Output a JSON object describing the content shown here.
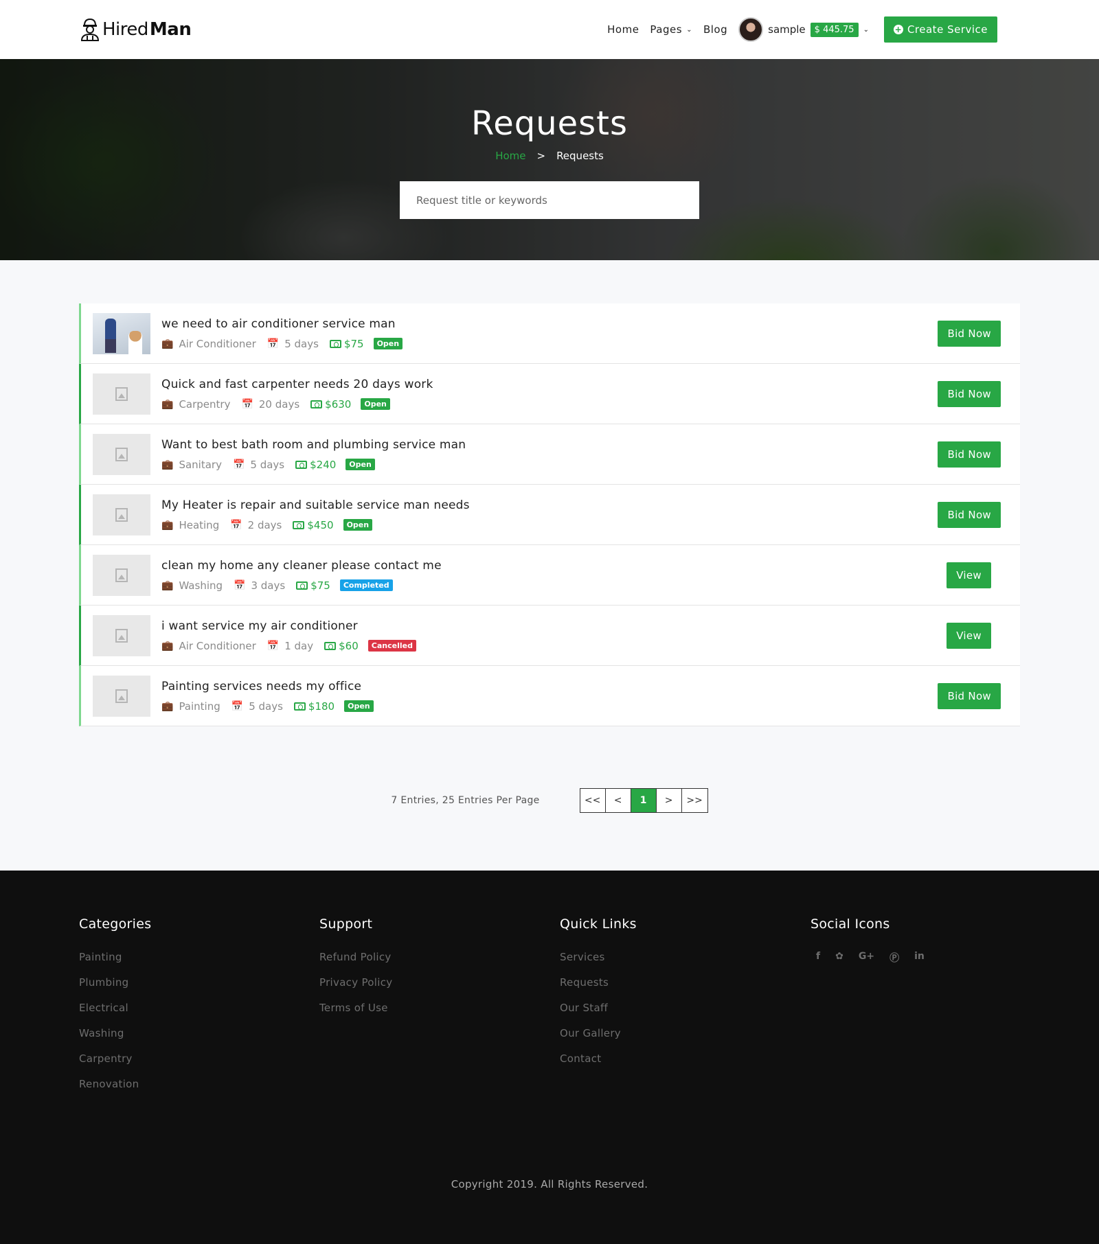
{
  "header": {
    "logo_light": "Hired",
    "logo_bold": "Man",
    "nav": [
      "Home",
      "Pages",
      "Blog"
    ],
    "user_name": "sample",
    "balance": "$ 445.75",
    "create_label": "Create Service"
  },
  "hero": {
    "title": "Requests",
    "breadcrumb_home": "Home",
    "breadcrumb_sep": ">",
    "breadcrumb_current": "Requests",
    "search_placeholder": "Request title or keywords"
  },
  "requests": [
    {
      "title": "we need to air conditioner service man",
      "category": "Air Conditioner",
      "duration": "5 days",
      "price": "$75",
      "status": "Open",
      "status_type": "open",
      "action": "Bid Now",
      "thumb": "photo"
    },
    {
      "title": "Quick and fast carpenter needs 20 days work",
      "category": "Carpentry",
      "duration": "20 days",
      "price": "$630",
      "status": "Open",
      "status_type": "open",
      "action": "Bid Now",
      "thumb": "placeholder"
    },
    {
      "title": "Want to best bath room and plumbing service man",
      "category": "Sanitary",
      "duration": "5 days",
      "price": "$240",
      "status": "Open",
      "status_type": "open",
      "action": "Bid Now",
      "thumb": "placeholder"
    },
    {
      "title": "My Heater is repair and suitable service man needs",
      "category": "Heating",
      "duration": "2 days",
      "price": "$450",
      "status": "Open",
      "status_type": "open",
      "action": "Bid Now",
      "thumb": "placeholder"
    },
    {
      "title": "clean my home any cleaner please contact me",
      "category": "Washing",
      "duration": "3 days",
      "price": "$75",
      "status": "Completed",
      "status_type": "completed",
      "action": "View",
      "thumb": "placeholder"
    },
    {
      "title": "i want service my air conditioner",
      "category": "Air Conditioner",
      "duration": "1 day",
      "price": "$60",
      "status": "Cancelled",
      "status_type": "cancelled",
      "action": "View",
      "thumb": "placeholder"
    },
    {
      "title": "Painting services needs my office",
      "category": "Painting",
      "duration": "5 days",
      "price": "$180",
      "status": "Open",
      "status_type": "open",
      "action": "Bid Now",
      "thumb": "placeholder"
    }
  ],
  "pagination": {
    "summary": "7 Entries, 25 Entries Per Page",
    "first": "<<",
    "prev": "<",
    "current": "1",
    "next": ">",
    "last": ">>"
  },
  "footer": {
    "categories_title": "Categories",
    "categories": [
      "Painting",
      "Plumbing",
      "Electrical",
      "Washing",
      "Carpentry",
      "Renovation"
    ],
    "support_title": "Support",
    "support": [
      "Refund Policy",
      "Privacy Policy",
      "Terms of Use"
    ],
    "links_title": "Quick Links",
    "links": [
      "Services",
      "Requests",
      "Our Staff",
      "Our Gallery",
      "Contact"
    ],
    "social_title": "Social Icons",
    "social_icons": [
      "facebook-icon",
      "twitter-icon",
      "google-plus-icon",
      "pinterest-icon",
      "linkedin-icon"
    ],
    "copyright": "Copyright 2019. All Rights Reserved."
  },
  "colors": {
    "accent": "#28a745",
    "completed": "#17a2e8",
    "cancelled": "#dc3545",
    "footer_bg": "#0f0f0f"
  }
}
